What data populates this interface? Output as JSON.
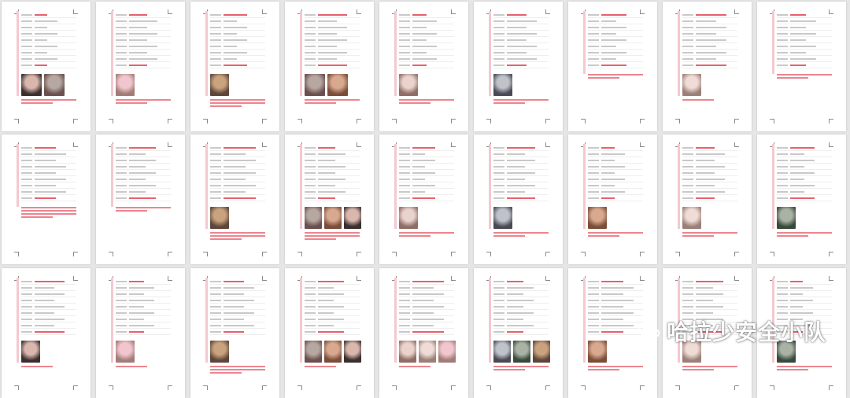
{
  "watermark": {
    "text": "哈拉少安全小队",
    "icon": "wechat-chat-bubbles-icon"
  },
  "colors": {
    "background": "#e6e6e6",
    "page": "#ffffff",
    "accent_red": "#e2515f",
    "sidebar_pink": "#f3c9cf",
    "text_gray": "#9c9c9c"
  },
  "pages": [
    {
      "photos": 2,
      "paragraph_lines": 2
    },
    {
      "photos": 1,
      "paragraph_lines": 2
    },
    {
      "photos": 1,
      "paragraph_lines": 3
    },
    {
      "photos": 2,
      "paragraph_lines": 2
    },
    {
      "photos": 1,
      "paragraph_lines": 2
    },
    {
      "photos": 1,
      "paragraph_lines": 2
    },
    {
      "photos": 0,
      "paragraph_lines": 2
    },
    {
      "photos": 1,
      "paragraph_lines": 1
    },
    {
      "photos": 0,
      "paragraph_lines": 2
    },
    {
      "photos": 0,
      "paragraph_lines": 4
    },
    {
      "photos": 0,
      "paragraph_lines": 2
    },
    {
      "photos": 1,
      "paragraph_lines": 3
    },
    {
      "photos": 3,
      "paragraph_lines": 3
    },
    {
      "photos": 1,
      "paragraph_lines": 2
    },
    {
      "photos": 1,
      "paragraph_lines": 2
    },
    {
      "photos": 1,
      "paragraph_lines": 2
    },
    {
      "photos": 1,
      "paragraph_lines": 2
    },
    {
      "photos": 1,
      "paragraph_lines": 2
    },
    {
      "photos": 1,
      "paragraph_lines": 1
    },
    {
      "photos": 1,
      "paragraph_lines": 1
    },
    {
      "photos": 1,
      "paragraph_lines": 3
    },
    {
      "photos": 3,
      "paragraph_lines": 1
    },
    {
      "photos": 3,
      "paragraph_lines": 1
    },
    {
      "photos": 3,
      "paragraph_lines": 2
    },
    {
      "photos": 1,
      "paragraph_lines": 2
    },
    {
      "photos": 1,
      "paragraph_lines": 2
    },
    {
      "photos": 1,
      "paragraph_lines": 2
    }
  ]
}
